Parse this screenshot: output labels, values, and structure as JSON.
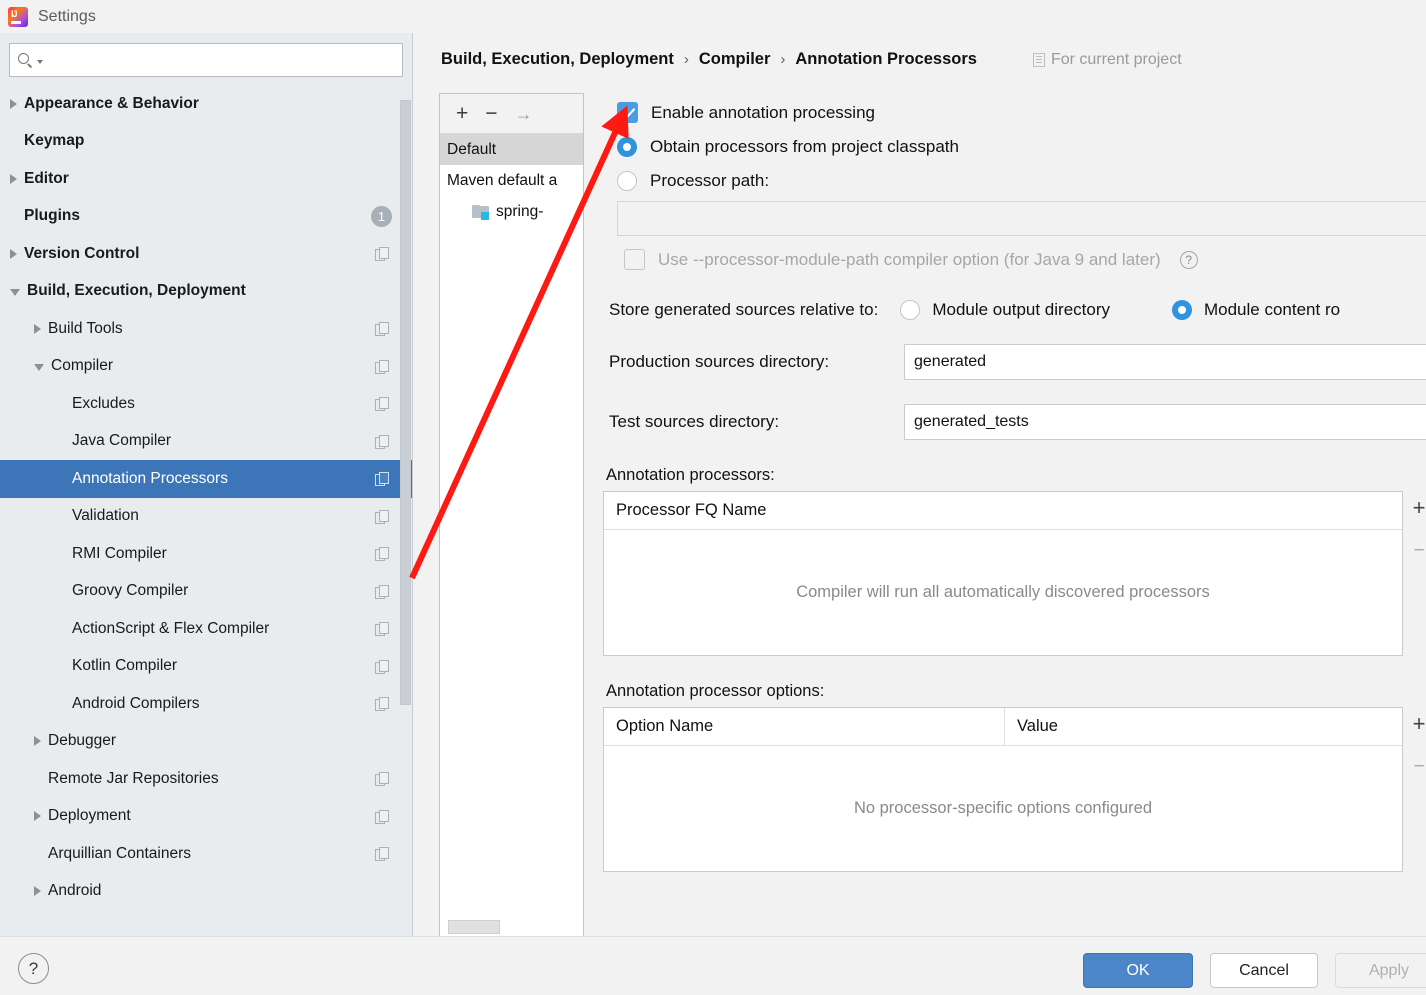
{
  "window": {
    "title": "Settings",
    "logo_icon": "intellij-idea-logo"
  },
  "search": {
    "placeholder": "",
    "value": "",
    "icon": "search-icon"
  },
  "sidebar": {
    "items": [
      {
        "label": "Appearance & Behavior",
        "indent": 0,
        "arrow": "collapsed",
        "bold": true,
        "copy": false,
        "badge": null,
        "selected": false
      },
      {
        "label": "Keymap",
        "indent": 0,
        "arrow": "none",
        "bold": true,
        "copy": false,
        "badge": null,
        "selected": false
      },
      {
        "label": "Editor",
        "indent": 0,
        "arrow": "collapsed",
        "bold": true,
        "copy": false,
        "badge": null,
        "selected": false
      },
      {
        "label": "Plugins",
        "indent": 0,
        "arrow": "none",
        "bold": true,
        "copy": false,
        "badge": "1",
        "selected": false
      },
      {
        "label": "Version Control",
        "indent": 0,
        "arrow": "collapsed",
        "bold": true,
        "copy": true,
        "badge": null,
        "selected": false
      },
      {
        "label": "Build, Execution, Deployment",
        "indent": 0,
        "arrow": "expanded",
        "bold": true,
        "copy": false,
        "badge": null,
        "selected": false
      },
      {
        "label": "Build Tools",
        "indent": 1,
        "arrow": "collapsed",
        "bold": false,
        "copy": true,
        "badge": null,
        "selected": false
      },
      {
        "label": "Compiler",
        "indent": 1,
        "arrow": "expanded",
        "bold": false,
        "copy": true,
        "badge": null,
        "selected": false
      },
      {
        "label": "Excludes",
        "indent": 2,
        "arrow": "none",
        "bold": false,
        "copy": true,
        "badge": null,
        "selected": false
      },
      {
        "label": "Java Compiler",
        "indent": 2,
        "arrow": "none",
        "bold": false,
        "copy": true,
        "badge": null,
        "selected": false
      },
      {
        "label": "Annotation Processors",
        "indent": 2,
        "arrow": "none",
        "bold": false,
        "copy": true,
        "badge": null,
        "selected": true
      },
      {
        "label": "Validation",
        "indent": 2,
        "arrow": "none",
        "bold": false,
        "copy": true,
        "badge": null,
        "selected": false
      },
      {
        "label": "RMI Compiler",
        "indent": 2,
        "arrow": "none",
        "bold": false,
        "copy": true,
        "badge": null,
        "selected": false
      },
      {
        "label": "Groovy Compiler",
        "indent": 2,
        "arrow": "none",
        "bold": false,
        "copy": true,
        "badge": null,
        "selected": false
      },
      {
        "label": "ActionScript & Flex Compiler",
        "indent": 2,
        "arrow": "none",
        "bold": false,
        "copy": true,
        "badge": null,
        "selected": false
      },
      {
        "label": "Kotlin Compiler",
        "indent": 2,
        "arrow": "none",
        "bold": false,
        "copy": true,
        "badge": null,
        "selected": false
      },
      {
        "label": "Android Compilers",
        "indent": 2,
        "arrow": "none",
        "bold": false,
        "copy": true,
        "badge": null,
        "selected": false
      },
      {
        "label": "Debugger",
        "indent": 1,
        "arrow": "collapsed",
        "bold": false,
        "copy": false,
        "badge": null,
        "selected": false
      },
      {
        "label": "Remote Jar Repositories",
        "indent": 1,
        "arrow": "none",
        "bold": false,
        "copy": true,
        "badge": null,
        "selected": false
      },
      {
        "label": "Deployment",
        "indent": 1,
        "arrow": "collapsed",
        "bold": false,
        "copy": true,
        "badge": null,
        "selected": false
      },
      {
        "label": "Arquillian Containers",
        "indent": 1,
        "arrow": "none",
        "bold": false,
        "copy": true,
        "badge": null,
        "selected": false
      },
      {
        "label": "Android",
        "indent": 1,
        "arrow": "collapsed",
        "bold": false,
        "copy": false,
        "badge": null,
        "selected": false
      }
    ]
  },
  "breadcrumb": {
    "items": [
      "Build, Execution, Deployment",
      "Compiler",
      "Annotation Processors"
    ],
    "separator": "›",
    "scope_label": "For current project",
    "scope_icon": "document-icon"
  },
  "profiles": {
    "toolbar": {
      "add": "+",
      "remove": "−",
      "move": "→"
    },
    "rows": [
      {
        "label": "Default",
        "selected": true,
        "icon": null
      },
      {
        "label": "Maven default a",
        "selected": false,
        "icon": null
      },
      {
        "label": "spring-",
        "selected": false,
        "icon": "folder-icon"
      }
    ]
  },
  "form": {
    "enable_annotation_processing": {
      "label": "Enable annotation processing",
      "checked": true
    },
    "source_mode": {
      "obtain_from_classpath": {
        "label": "Obtain processors from project classpath",
        "selected": true
      },
      "processor_path": {
        "label": "Processor path:",
        "selected": false,
        "value": ""
      }
    },
    "use_module_path": {
      "label": "Use --processor-module-path compiler option (for Java 9 and later)",
      "checked": false,
      "disabled": true,
      "help_icon": "question-icon"
    },
    "store_relative": {
      "label": "Store generated sources relative to:",
      "module_output": {
        "label": "Module output directory",
        "selected": false
      },
      "module_content_root": {
        "label": "Module content ro",
        "selected": true
      }
    },
    "production_sources": {
      "label": "Production sources directory:",
      "value": "generated"
    },
    "test_sources": {
      "label": "Test sources directory:",
      "value": "generated_tests"
    },
    "processors_table": {
      "section_label": "Annotation processors:",
      "columns": [
        "Processor FQ Name"
      ],
      "rows": [],
      "empty_text": "Compiler will run all automatically discovered processors",
      "add_btn": "+",
      "remove_btn": "−"
    },
    "options_table": {
      "section_label": "Annotation processor options:",
      "columns": [
        "Option Name",
        "Value"
      ],
      "rows": [],
      "empty_text": "No processor-specific options configured",
      "add_btn": "+",
      "remove_btn": "−"
    }
  },
  "footer": {
    "help": "?",
    "ok": "OK",
    "cancel": "Cancel",
    "apply": "Apply"
  },
  "annotation": {
    "arrow_color": "#fc1a12",
    "description": "red-arrow-pointing-to-enable-checkbox"
  },
  "colors": {
    "accent_blue": "#3d76b8",
    "checkbox_blue": "#4a9ee0",
    "ok_button": "#4a86c8",
    "sidebar_bg": "#e8ecef"
  }
}
